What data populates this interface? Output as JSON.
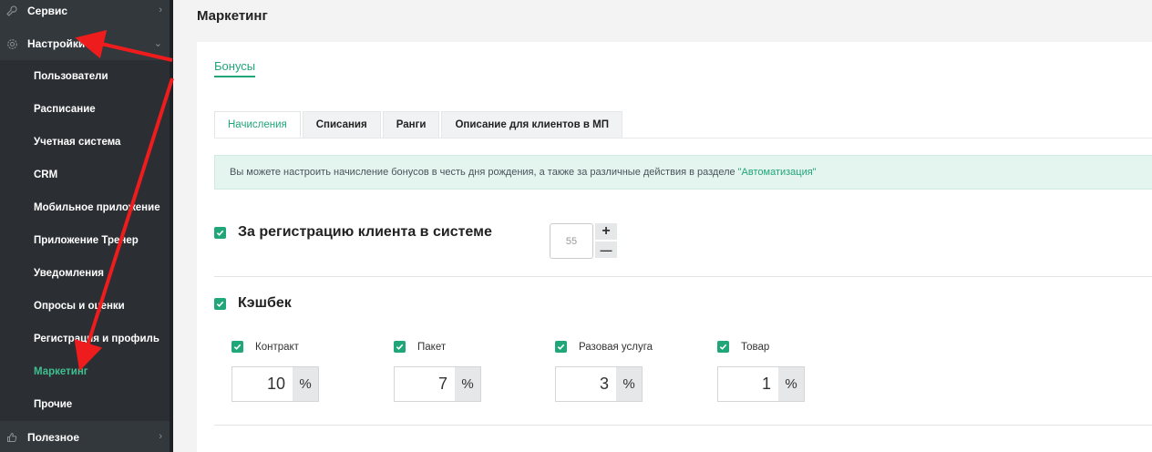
{
  "sidebar": {
    "top_items": [
      {
        "label": "Сервис",
        "icon": "wrench-icon"
      },
      {
        "label": "Настройки",
        "icon": "gear-icon"
      }
    ],
    "sub_items": [
      "Пользователи",
      "Расписание",
      "Учетная система",
      "CRM",
      "Мобильное приложение",
      "Приложение Тренер",
      "Уведомления",
      "Опросы и оценки",
      "Регистрация и профиль",
      "Маркетинг",
      "Прочие"
    ],
    "active_sub": "Маркетинг",
    "bottom_item": {
      "label": "Полезное",
      "icon": "thumb-up-icon"
    },
    "chevron_right": "›",
    "chevron_down": "⌄"
  },
  "page": {
    "title": "Маркетинг",
    "subtab": "Бонусы",
    "tabs": [
      "Начисления",
      "Списания",
      "Ранги",
      "Описание для клиентов в МП"
    ],
    "active_tab": "Начисления",
    "info_text": "Вы можете настроить начисление бонусов в честь дня рождения, а также за различные действия в разделе",
    "info_link": "\"Автоматизация\"",
    "registration": {
      "label": "За регистрацию клиента в системе",
      "checked": true,
      "placeholder": "55",
      "plus": "+",
      "minus": "—"
    },
    "cashback": {
      "label": "Кэшбек",
      "checked": true,
      "options": [
        {
          "label": "Контракт",
          "value": "10",
          "unit": "%",
          "checked": true
        },
        {
          "label": "Пакет",
          "value": "7",
          "unit": "%",
          "checked": true
        },
        {
          "label": "Разовая услуга",
          "value": "3",
          "unit": "%",
          "checked": true
        },
        {
          "label": "Товар",
          "value": "1",
          "unit": "%",
          "checked": true
        }
      ]
    }
  },
  "colors": {
    "accent": "#21a67a",
    "sidebar_bg": "#2b2f33",
    "annotation_arrow": "#ee1c1c"
  }
}
